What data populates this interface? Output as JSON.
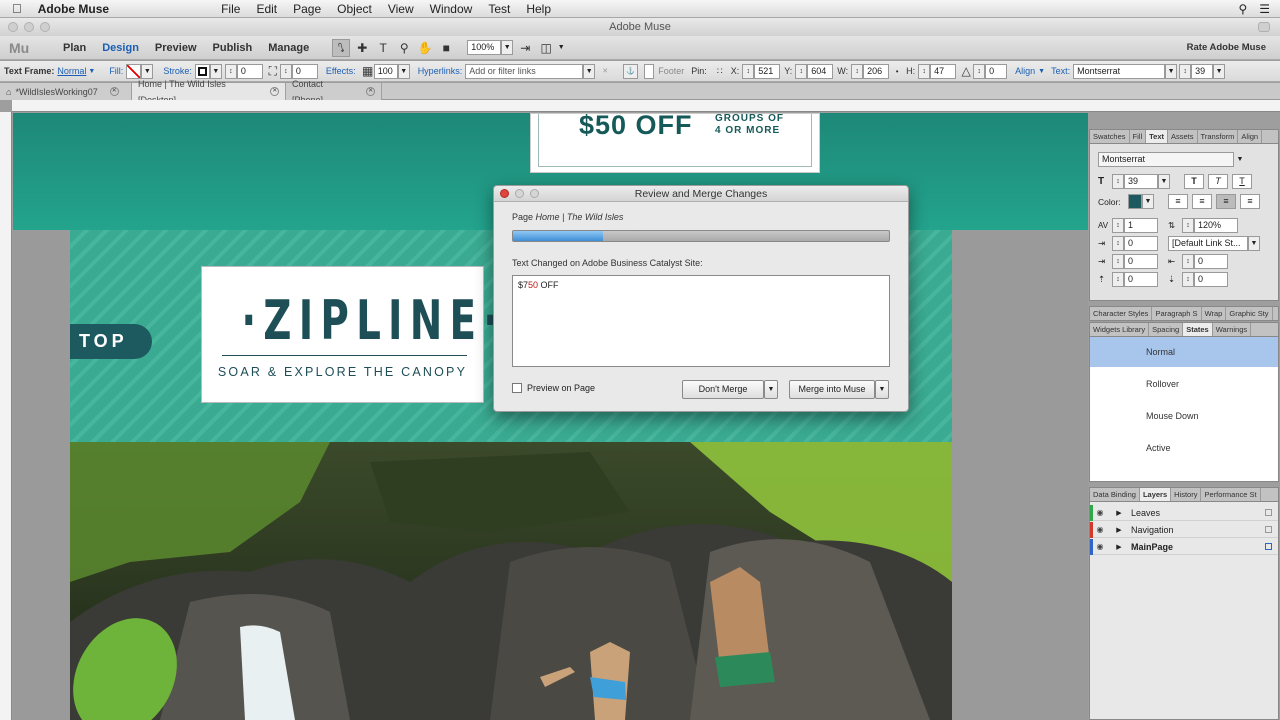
{
  "menubar": {
    "app_name": "Adobe Muse",
    "items": [
      "File",
      "Edit",
      "Page",
      "Object",
      "View",
      "Window",
      "Test",
      "Help"
    ]
  },
  "window": {
    "title": "Adobe Muse"
  },
  "toolbar": {
    "logo": "Mu",
    "nav": [
      "Plan",
      "Design",
      "Preview",
      "Publish",
      "Manage"
    ],
    "active_nav": "Design",
    "zoom": "100%",
    "rate_label": "Rate Adobe Muse"
  },
  "controlbar": {
    "text_frame_label": "Text Frame:",
    "text_frame_state": "Normal",
    "fill_label": "Fill:",
    "stroke_label": "Stroke:",
    "stroke_width": "0",
    "corner_radius": "0",
    "effects_label": "Effects:",
    "opacity": "100",
    "hyperlinks_label": "Hyperlinks:",
    "hyperlinks_placeholder": "Add or filter links",
    "footer_label": "Footer",
    "pin_label": "Pin:",
    "x_label": "X:",
    "x": "521",
    "y_label": "Y:",
    "y": "604",
    "w_label": "W:",
    "w": "206",
    "h_label": "H:",
    "h": "47",
    "rotation": "0",
    "align_label": "Align",
    "text_label": "Text:",
    "font": "Montserrat",
    "font_size": "39"
  },
  "tabs": [
    {
      "label": "*WildIslesWorking07",
      "active": false
    },
    {
      "label": "Home | The Wild Isles [Desktop]",
      "active": true
    },
    {
      "label": "Contact [Phone]",
      "active": false
    }
  ],
  "canvas": {
    "promo_price": "$50 OFF",
    "promo_groups_line1": "GROUPS OF",
    "promo_groups_line2": "4 OR MORE",
    "card_title": "·ZIPLINE·",
    "card_subtitle": "SOAR & EXPLORE THE CANOPY",
    "top_pill": "TOP"
  },
  "dialog": {
    "title": "Review and Merge Changes",
    "page_prefix": "Page",
    "page_name": "Home | The Wild Isles",
    "progress": 0.24,
    "changed_label": "Text Changed on Adobe Business Catalyst Site:",
    "old_text": "$7",
    "old_text_red": "50",
    "new_text_rest": " OFF",
    "preview_label": "Preview on Page",
    "dont_merge_label": "Don't Merge",
    "merge_label": "Merge into Muse"
  },
  "panels": {
    "top_tabs": [
      "Swatches",
      "Fill",
      "Text",
      "Assets",
      "Transform",
      "Align"
    ],
    "top_active": "Text",
    "font": "Montserrat",
    "font_size": "39",
    "color_label": "Color:",
    "tracking": "1",
    "leading": "120%",
    "indent_a": "0",
    "link_style": "[Default Link St...",
    "left_indent": "0",
    "right_indent": "0",
    "space_before": "0",
    "space_after": "0",
    "style_tabs": [
      "Character Styles",
      "Paragraph S",
      "Wrap",
      "Graphic Sty"
    ],
    "widget_tabs": [
      "Widgets Library",
      "Spacing",
      "States",
      "Warnings"
    ],
    "widget_active": "States",
    "states": [
      "Normal",
      "Rollover",
      "Mouse Down",
      "Active"
    ],
    "selected_state": "Normal",
    "layer_tabs": [
      "Data Binding",
      "Layers",
      "History",
      "Performance St"
    ],
    "layer_active": "Layers",
    "layers": [
      {
        "name": "Leaves",
        "color": "#2ea84a",
        "bold": false
      },
      {
        "name": "Navigation",
        "color": "#d33a2c",
        "bold": false
      },
      {
        "name": "MainPage",
        "color": "#2f64c8",
        "bold": true
      }
    ]
  },
  "colors": {
    "accent": "#1a5fb4",
    "teal": "#23a48d",
    "dark_teal": "#1e4f57",
    "progress": "#3f8fd6",
    "selected_state": "#a8c6ec"
  }
}
